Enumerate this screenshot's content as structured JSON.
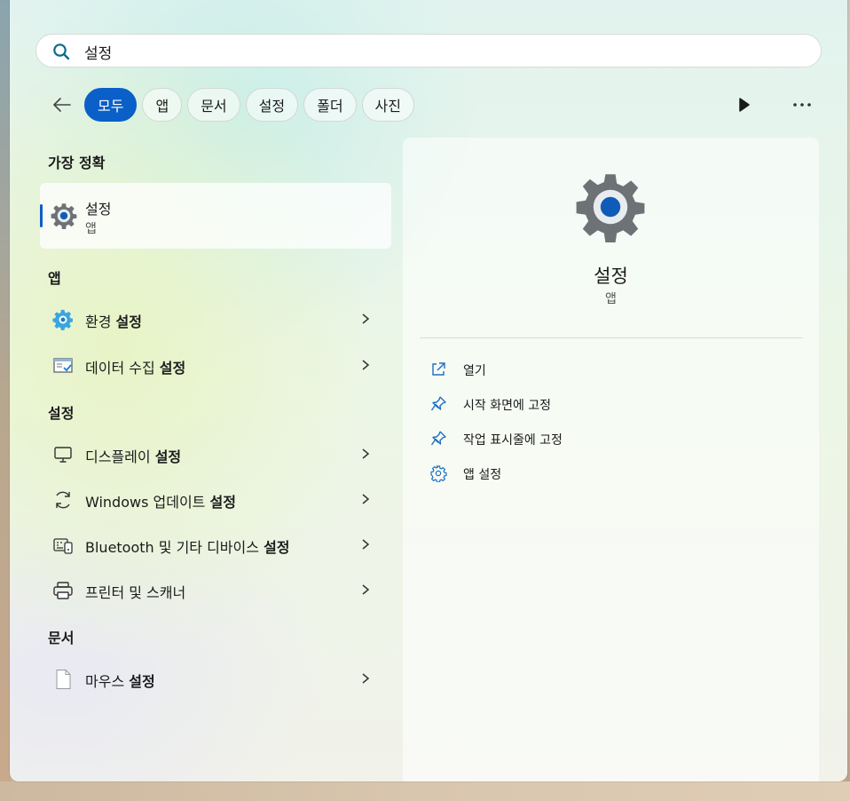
{
  "search": {
    "value": "설정",
    "placeholder": ""
  },
  "filters": [
    "모두",
    "앱",
    "문서",
    "설정",
    "폴더",
    "사진"
  ],
  "best_match": {
    "title": "가장 정확",
    "name": "설정",
    "type": "앱"
  },
  "apps": {
    "title": "앱",
    "items": [
      {
        "label_pre": "환경 ",
        "label_bold": "설정"
      },
      {
        "label_pre": "데이터 수집 ",
        "label_bold": "설정"
      }
    ]
  },
  "settings": {
    "title": "설정",
    "items": [
      {
        "label_pre": "디스플레이 ",
        "label_bold": "설정"
      },
      {
        "label_pre": "Windows 업데이트 ",
        "label_bold": "설정"
      },
      {
        "label_pre": "Bluetooth 및 기타 디바이스 ",
        "label_bold": "설정"
      },
      {
        "label_pre": "프린터 및 스캐너",
        "label_bold": ""
      }
    ]
  },
  "documents": {
    "title": "문서",
    "items": [
      {
        "label_pre": "마우스 ",
        "label_bold": "설정"
      }
    ]
  },
  "detail": {
    "name": "설정",
    "type": "앱",
    "actions": [
      "열기",
      "시작 화면에 고정",
      "작업 표시줄에 고정",
      "앱 설정"
    ]
  },
  "colors": {
    "accent": "#0a5fc8"
  }
}
